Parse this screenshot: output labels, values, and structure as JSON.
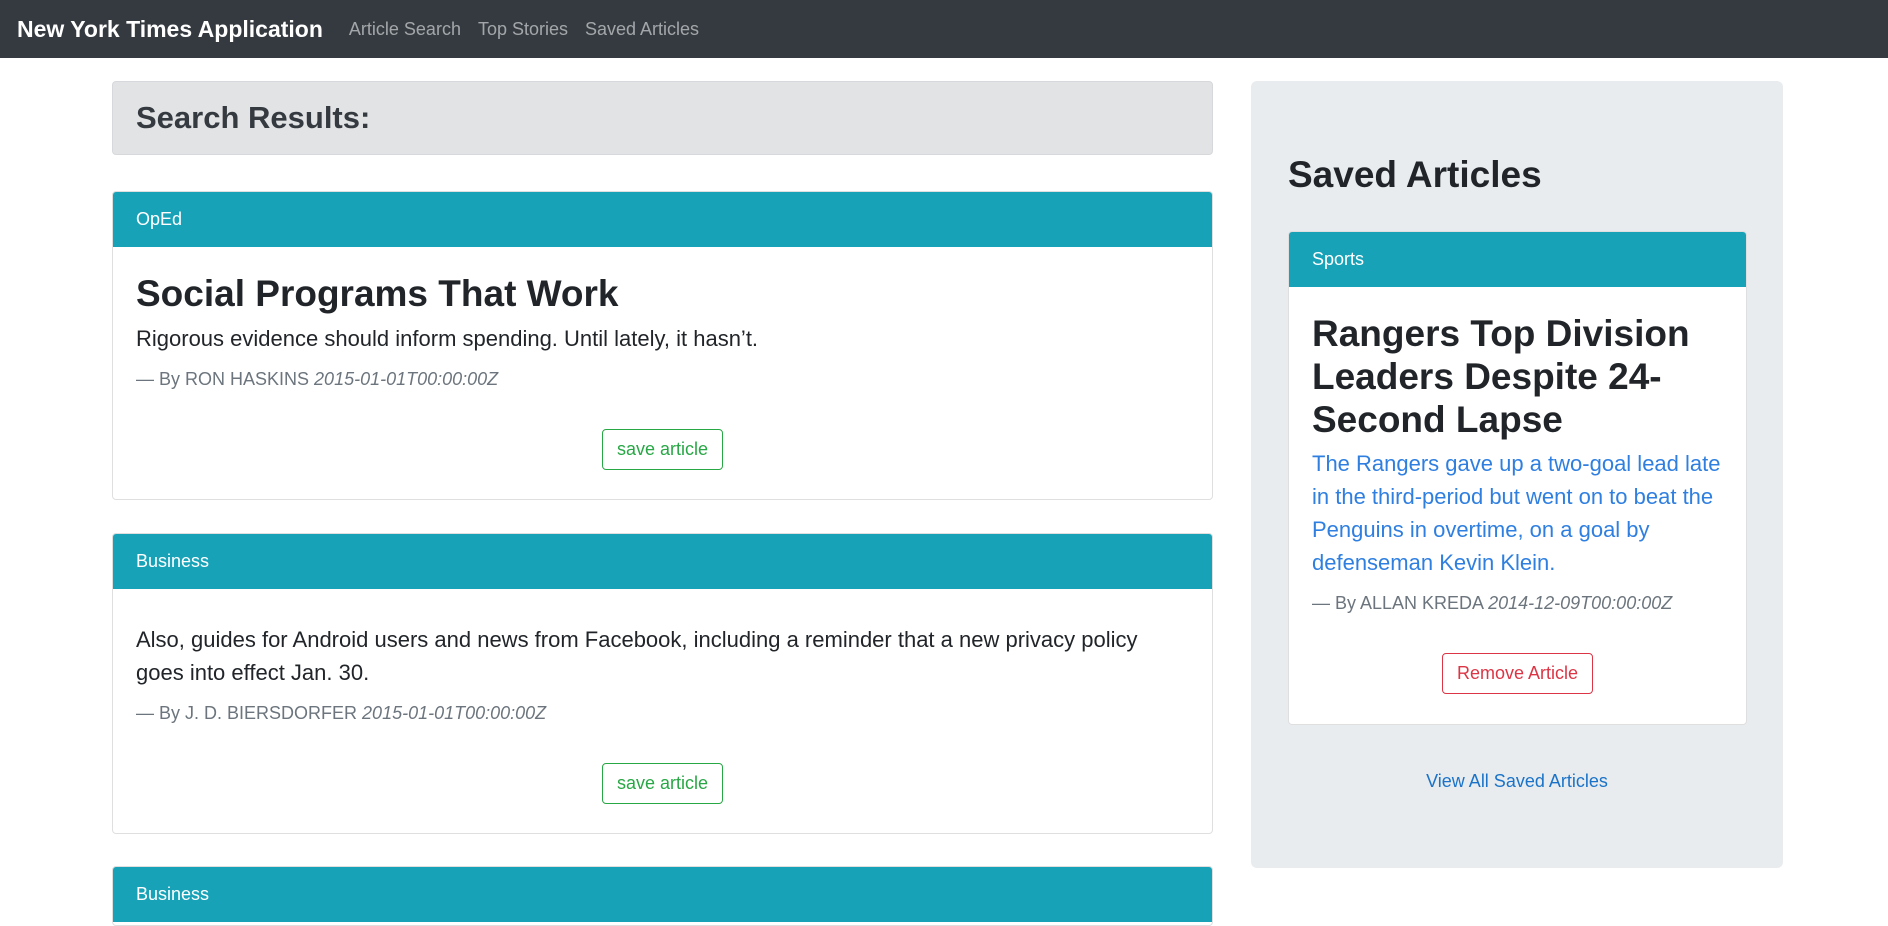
{
  "navbar": {
    "brand": "New York Times Application",
    "links": [
      "Article Search",
      "Top Stories",
      "Saved Articles"
    ]
  },
  "results": {
    "heading": "Search Results:",
    "articles": [
      {
        "section": "OpEd",
        "headline": "Social Programs That Work",
        "snippet": "Rigorous evidence should inform spending. Until lately, it hasn’t.",
        "byline": "— By RON HASKINS",
        "date": "2015-01-01T00:00:00Z",
        "button": "save article"
      },
      {
        "section": "Business",
        "headline": "",
        "snippet": "Also, guides for Android users and news from Facebook, including a reminder that a new privacy policy goes into effect Jan. 30.",
        "byline": "— By J. D. BIERSDORFER",
        "date": "2015-01-01T00:00:00Z",
        "button": "save article"
      },
      {
        "section": "Business"
      }
    ]
  },
  "saved": {
    "heading": "Saved Articles",
    "article": {
      "section": "Sports",
      "headline": "Rangers Top Division Leaders Despite 24-Second Lapse",
      "snippet": "The Rangers gave up a two-goal lead late in the third-period but went on to beat the Penguins in overtime, on a goal by defenseman Kevin Klein.",
      "byline": "— By ALLAN KREDA",
      "date": "2014-12-09T00:00:00Z",
      "button": "Remove Article"
    },
    "view_all": "View All Saved Articles"
  },
  "colors": {
    "navbar": "#343a40",
    "card_header": "#17a2b8",
    "save_button": "#28a745",
    "remove_button": "#dc3545",
    "link": "#1a73c8"
  }
}
